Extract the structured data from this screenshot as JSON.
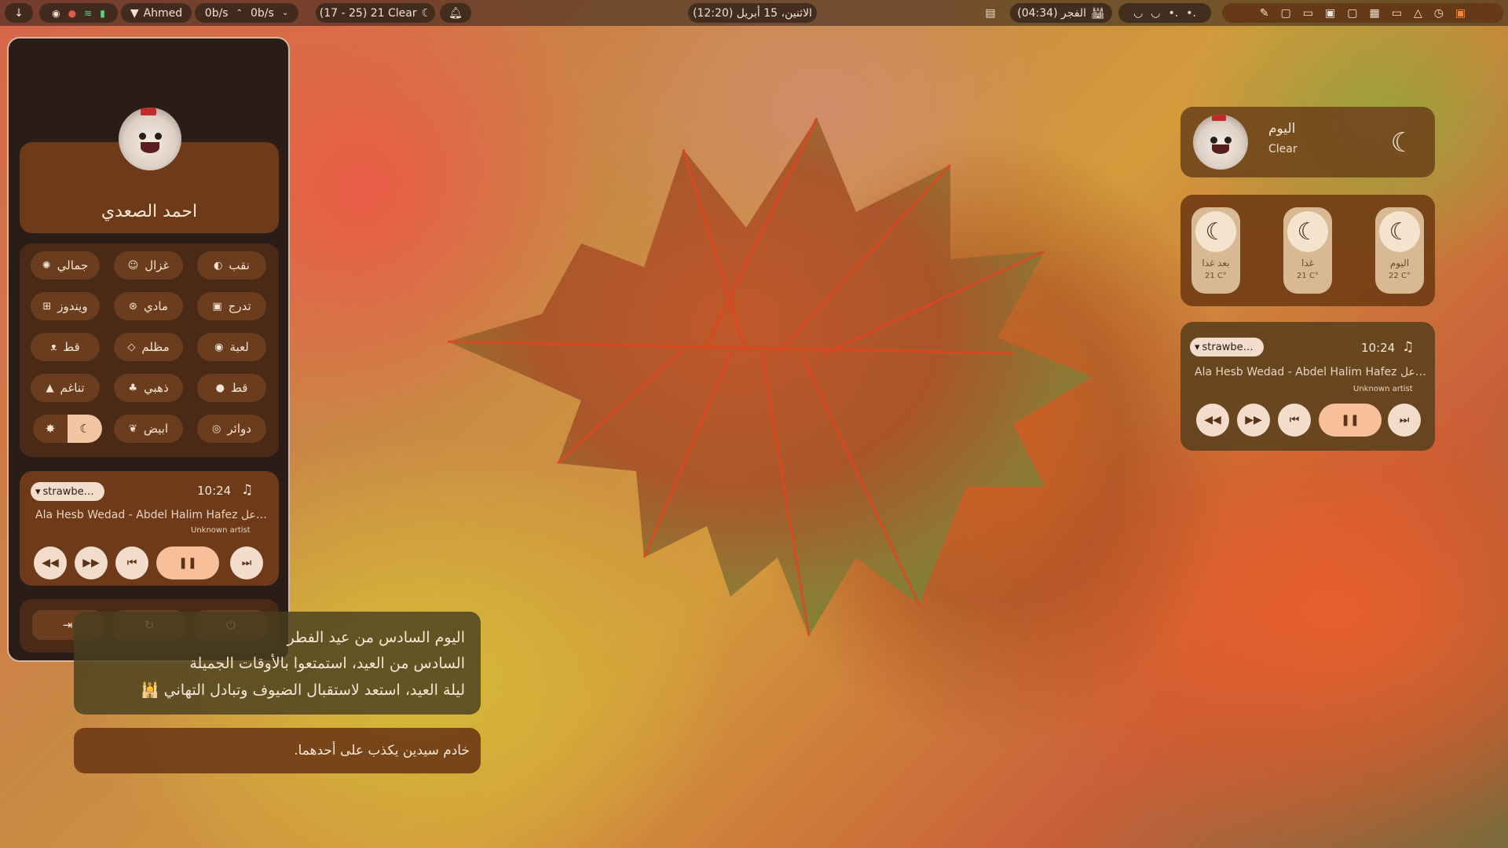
{
  "topbar": {
    "user": "Ahmed",
    "net_up": "0b/s",
    "net_down": "0b/s",
    "weather": "(17 - 25) 21 Clear",
    "datetime": "(12:20) الاثنين، 15 أبريل",
    "prayer": "الفجر (04:34)"
  },
  "profile": {
    "name": "احمد الصعدي"
  },
  "theme_buttons": [
    {
      "label": "نقب",
      "icon": "circle-icon"
    },
    {
      "label": "غزال",
      "icon": "deer-icon"
    },
    {
      "label": "جمالي",
      "icon": "palette-icon"
    },
    {
      "label": "تدرج",
      "icon": "gradient-icon"
    },
    {
      "label": "مادي",
      "icon": "material-icon"
    },
    {
      "label": "ويندوز",
      "icon": "windows-icon"
    },
    {
      "label": "لعبة",
      "icon": "gamepad-icon"
    },
    {
      "label": "مظلم",
      "icon": "diamond-icon"
    },
    {
      "label": "قط",
      "icon": "cat-icon"
    },
    {
      "label": "قط",
      "icon": "paw-icon"
    },
    {
      "label": "ذهبي",
      "icon": "gold-icon"
    },
    {
      "label": "تناغم",
      "icon": "mountain-icon"
    },
    {
      "label": "دوائر",
      "icon": "circles-icon"
    },
    {
      "label": "ابيض",
      "icon": "leaf-icon"
    }
  ],
  "music": {
    "source": "strawbe…",
    "time": "10:24",
    "title": "Ala Hesb Wedad  - Abdel Halim Hafez عل…",
    "artist": "Unknown artist"
  },
  "notifications": {
    "first_lines": [
      "اليوم السادس من عيد الفطر",
      "السادس من العيد، استمتعوا بالأوقات الجميلة",
      "ليلة العيد، استعد لاستقبال الضيوف وتبادل التهاني 🕌"
    ],
    "second": "خادم سيدين يكذب على أحدهما."
  },
  "weather": {
    "title": "اليوم",
    "condition": "Clear",
    "forecast": [
      {
        "day": "بعد غدا",
        "temp": "21 C°"
      },
      {
        "day": "غدا",
        "temp": "21 C°"
      },
      {
        "day": "اليوم",
        "temp": "22 C°"
      }
    ]
  }
}
